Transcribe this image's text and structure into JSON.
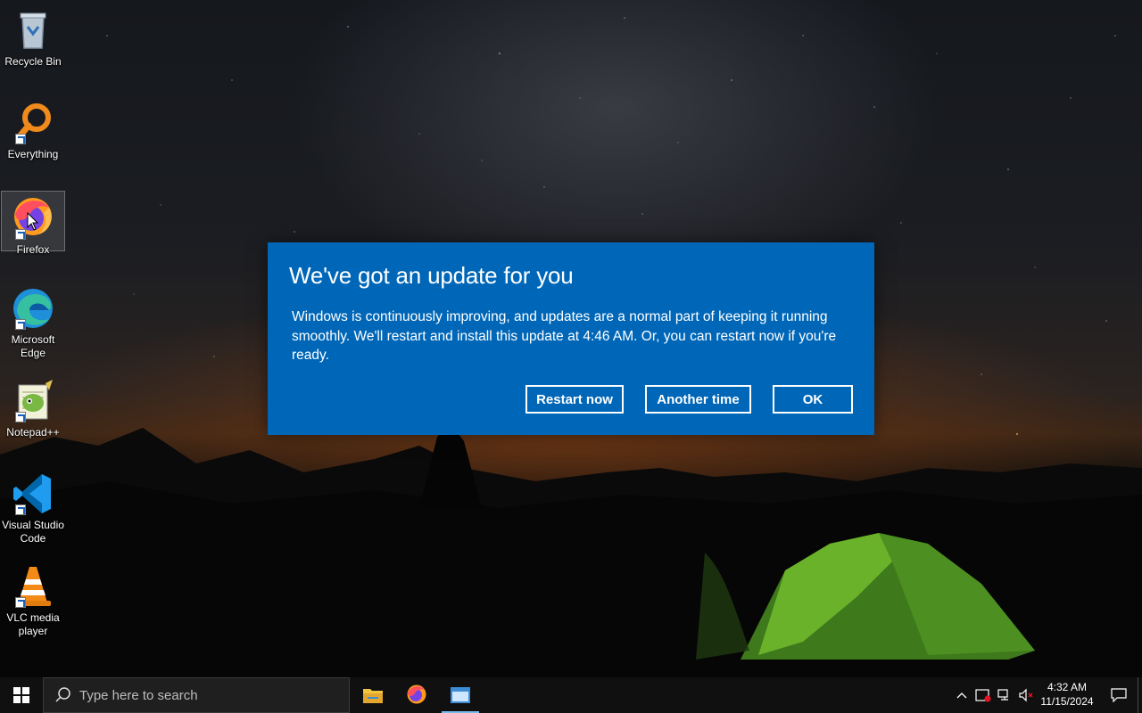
{
  "desktop": {
    "icons": [
      {
        "label": "Recycle Bin",
        "icon": "recycle-bin-icon"
      },
      {
        "label": "Everything",
        "icon": "everything-search-icon"
      },
      {
        "label": "Firefox",
        "icon": "firefox-icon",
        "selected": true
      },
      {
        "label": "Microsoft Edge",
        "icon": "edge-icon"
      },
      {
        "label": "Notepad++",
        "icon": "notepad-plus-plus-icon"
      },
      {
        "label": "Visual Studio Code",
        "icon": "vscode-icon"
      },
      {
        "label": "VLC media player",
        "icon": "vlc-icon"
      }
    ]
  },
  "dialog": {
    "title": "We've got an update for you",
    "body": "Windows is continuously improving, and updates are a normal part of keeping it running smoothly. We'll restart and install this update at 4:46 AM. Or, you can restart now if you're ready.",
    "buttons": {
      "restart_now": "Restart now",
      "another_time": "Another time",
      "ok": "OK"
    },
    "background_color": "#0067b8"
  },
  "taskbar": {
    "search_placeholder": "Type here to search",
    "pinned_apps": [
      {
        "name": "File Explorer",
        "icon": "file-explorer-icon"
      },
      {
        "name": "Firefox",
        "icon": "firefox-icon"
      },
      {
        "name": "Update dialog",
        "icon": "window-icon",
        "active": true
      }
    ],
    "tray": {
      "time": "4:32 AM",
      "date": "11/15/2024",
      "icons": [
        "chevron-up-icon",
        "security-icon",
        "network-icon",
        "volume-muted-icon",
        "notification-icon"
      ]
    }
  },
  "colors": {
    "accent": "#0067b8",
    "taskbar": "#101010",
    "active_indicator": "#76b9ed"
  }
}
